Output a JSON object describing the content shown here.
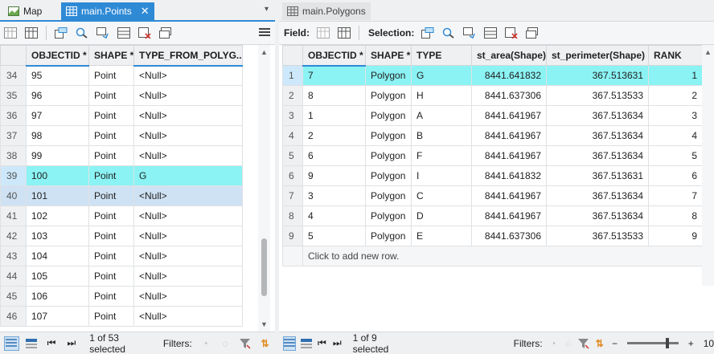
{
  "tabs_left": {
    "map_label": "Map",
    "points_label": "main.Points",
    "close_glyph": "✕",
    "chevron": "▾"
  },
  "tabs_right": {
    "polygons_label": "main.Polygons"
  },
  "left_table": {
    "columns": [
      "OBJECTID *",
      "SHAPE *",
      "TYPE_FROM_POLYG..."
    ],
    "rows": [
      {
        "row": "34",
        "oid": "95",
        "shape": "Point",
        "type": "<Null>"
      },
      {
        "row": "35",
        "oid": "96",
        "shape": "Point",
        "type": "<Null>"
      },
      {
        "row": "36",
        "oid": "97",
        "shape": "Point",
        "type": "<Null>"
      },
      {
        "row": "37",
        "oid": "98",
        "shape": "Point",
        "type": "<Null>"
      },
      {
        "row": "38",
        "oid": "99",
        "shape": "Point",
        "type": "<Null>"
      },
      {
        "row": "39",
        "oid": "100",
        "shape": "Point",
        "type": "G"
      },
      {
        "row": "40",
        "oid": "101",
        "shape": "Point",
        "type": "<Null>"
      },
      {
        "row": "41",
        "oid": "102",
        "shape": "Point",
        "type": "<Null>"
      },
      {
        "row": "42",
        "oid": "103",
        "shape": "Point",
        "type": "<Null>"
      },
      {
        "row": "43",
        "oid": "104",
        "shape": "Point",
        "type": "<Null>"
      },
      {
        "row": "44",
        "oid": "105",
        "shape": "Point",
        "type": "<Null>"
      },
      {
        "row": "45",
        "oid": "106",
        "shape": "Point",
        "type": "<Null>"
      },
      {
        "row": "46",
        "oid": "107",
        "shape": "Point",
        "type": "<Null>"
      }
    ],
    "selected_row": "39",
    "current_row": "40",
    "status_text": "1 of 53 selected",
    "filters_label": "Filters:"
  },
  "right_table": {
    "field_label": "Field:",
    "selection_label": "Selection:",
    "columns": [
      "OBJECTID *",
      "SHAPE *",
      "TYPE",
      "st_area(Shape)",
      "st_perimeter(Shape)",
      "RANK"
    ],
    "rows": [
      {
        "row": "1",
        "oid": "7",
        "shape": "Polygon",
        "type": "G",
        "area": "8441.641832",
        "perim": "367.513631",
        "rank": "1"
      },
      {
        "row": "2",
        "oid": "8",
        "shape": "Polygon",
        "type": "H",
        "area": "8441.637306",
        "perim": "367.513533",
        "rank": "2"
      },
      {
        "row": "3",
        "oid": "1",
        "shape": "Polygon",
        "type": "A",
        "area": "8441.641967",
        "perim": "367.513634",
        "rank": "3"
      },
      {
        "row": "4",
        "oid": "2",
        "shape": "Polygon",
        "type": "B",
        "area": "8441.641967",
        "perim": "367.513634",
        "rank": "4"
      },
      {
        "row": "5",
        "oid": "6",
        "shape": "Polygon",
        "type": "F",
        "area": "8441.641967",
        "perim": "367.513634",
        "rank": "5"
      },
      {
        "row": "6",
        "oid": "9",
        "shape": "Polygon",
        "type": "I",
        "area": "8441.641832",
        "perim": "367.513631",
        "rank": "6"
      },
      {
        "row": "7",
        "oid": "3",
        "shape": "Polygon",
        "type": "C",
        "area": "8441.641967",
        "perim": "367.513634",
        "rank": "7"
      },
      {
        "row": "8",
        "oid": "4",
        "shape": "Polygon",
        "type": "D",
        "area": "8441.641967",
        "perim": "367.513634",
        "rank": "8"
      },
      {
        "row": "9",
        "oid": "5",
        "shape": "Polygon",
        "type": "E",
        "area": "8441.637306",
        "perim": "367.513533",
        "rank": "9"
      }
    ],
    "selected_row": "1",
    "add_row_text": "Click to add new row.",
    "status_text": "1 of 9 selected",
    "filters_label": "Filters:",
    "zoom_minus": "−",
    "zoom_plus": "+",
    "zoom_value": "10"
  },
  "colors": {
    "accent": "#2f8ad6",
    "selected_row": "#8bf3f4",
    "current_row": "#cfe2f4"
  }
}
